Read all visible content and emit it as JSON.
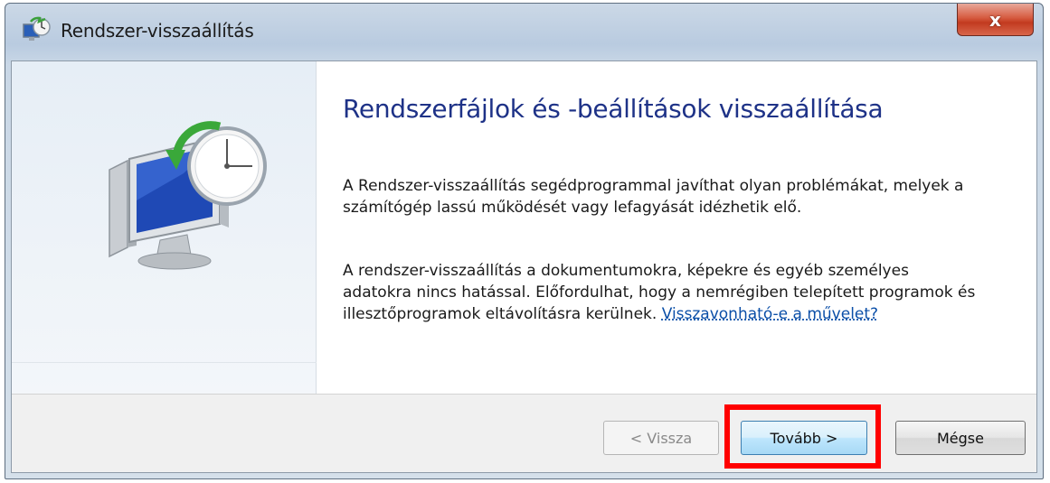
{
  "window": {
    "title": "Rendszer-visszaállítás",
    "close_glyph": "x"
  },
  "content": {
    "heading": "Rendszerfájlok és -beállítások visszaállítása",
    "paragraph1": "A Rendszer-visszaállítás segédprogrammal javíthat olyan problémákat, melyek a számítógép lassú működését vagy lefagyását idézhetik elő.",
    "paragraph2": "A rendszer-visszaállítás a dokumentumokra, képekre és egyéb személyes adatokra nincs hatással. Előfordulhat, hogy a nemrégiben telepített programok és illesztőprogramok eltávolításra kerülnek.",
    "link": "Visszavonható-e a művelet?"
  },
  "buttons": {
    "back": "< Vissza",
    "next": "Tovább >",
    "cancel": "Mégse"
  },
  "icons": {
    "title_icon": "system-restore-icon",
    "illustration": "system-restore-monitor-clock-icon"
  },
  "colors": {
    "heading": "#1e3287",
    "link": "#0b4fa8",
    "highlight": "#ff0000"
  }
}
